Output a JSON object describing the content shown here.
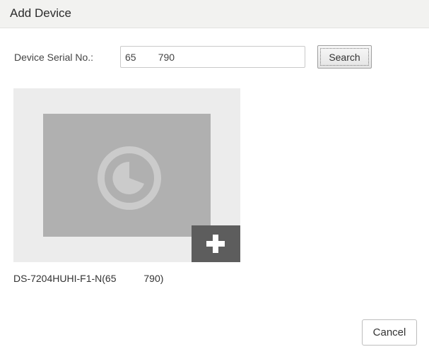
{
  "dialog": {
    "title": "Add Device"
  },
  "serial": {
    "label": "Device Serial No.:",
    "value": "65        790"
  },
  "search_button": {
    "label": "Search"
  },
  "device_result": {
    "label": "DS-7204HUHI-F1-N(65          790)",
    "thumbnail_icon": "camera-icon",
    "add_icon": "plus-icon"
  },
  "cancel_button": {
    "label": "Cancel"
  },
  "colors": {
    "title_bar": "#f2f2f0",
    "card_background": "#ececec",
    "thumbnail": "#b0b0b0",
    "add_button": "#5d5d5d"
  }
}
